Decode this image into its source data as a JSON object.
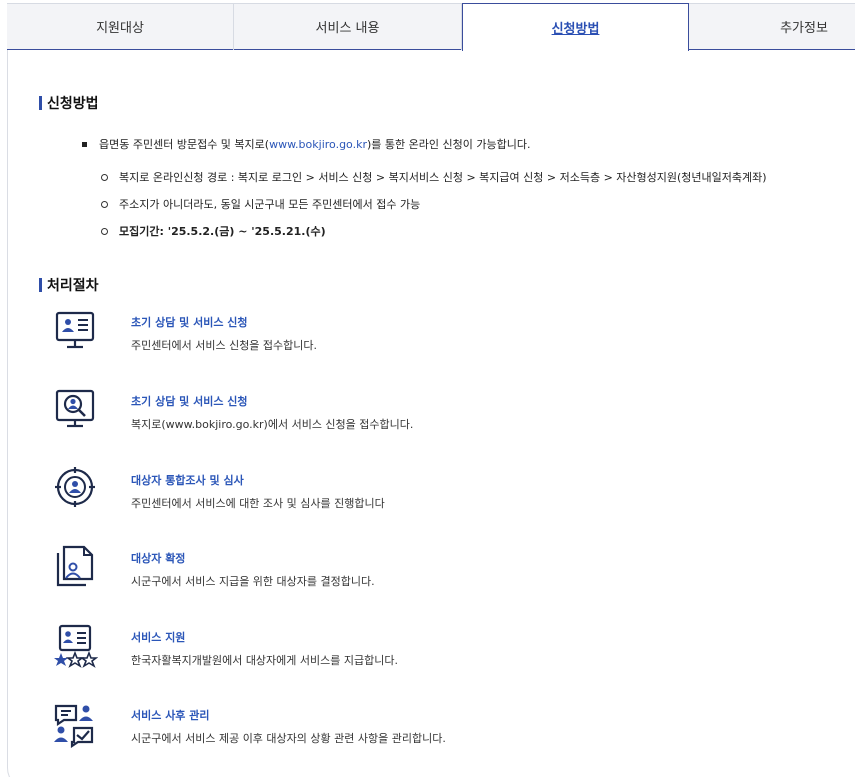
{
  "tabs": [
    {
      "label": "지원대상"
    },
    {
      "label": "서비스 내용"
    },
    {
      "label": "신청방법"
    },
    {
      "label": "추가정보"
    }
  ],
  "apply": {
    "title": "신청방법",
    "main_before": "읍면동 주민센터 방문접수 및 복지로(",
    "main_link": "www.bokjiro.go.kr",
    "main_after": ")를 통한 온라인 신청이 가능합니다.",
    "items": [
      "복지로 온라인신청 경로 : 복지로 로그인 > 서비스 신청 > 복지서비스 신청 > 복지급여 신청 > 저소득층 > 자산형성지원(청년내일저축계좌)",
      "주소지가 아니더라도, 동일 시군구내 모든 주민센터에서 접수 가능",
      "모집기간: '25.5.2.(금) ~ '25.5.21.(수)"
    ]
  },
  "process": {
    "title": "처리절차",
    "steps": [
      {
        "icon": "monitor-profile-icon",
        "title": "초기 상담 및 서비스 신청",
        "desc": "주민센터에서 서비스 신청을 접수합니다."
      },
      {
        "icon": "monitor-search-user-icon",
        "title": "초기 상담 및 서비스 신청",
        "desc": "복지로(www.bokjiro.go.kr)에서 서비스 신청을 접수합니다."
      },
      {
        "icon": "target-user-icon",
        "title": "대상자 통합조사 및 심사",
        "desc": "주민센터에서 서비스에 대한 조사 및 심사를 진행합니다"
      },
      {
        "icon": "document-user-icon",
        "title": "대상자 확정",
        "desc": "시군구에서 서비스 지급을 위한 대상자를 결정합니다."
      },
      {
        "icon": "profile-rating-icon",
        "title": "서비스 지원",
        "desc": "한국자활복지개발원에서 대상자에게 서비스를 지급합니다."
      },
      {
        "icon": "followup-manage-icon",
        "title": "서비스 사후 관리",
        "desc": "시군구에서 서비스 제공 이후 대상자의 상황 관련 사항을 관리합니다."
      }
    ]
  },
  "colors": {
    "accent": "#2f4ea8",
    "link": "#2b56b8",
    "icon_dark": "#1e2a4a",
    "icon_blue": "#2f4ea8"
  }
}
